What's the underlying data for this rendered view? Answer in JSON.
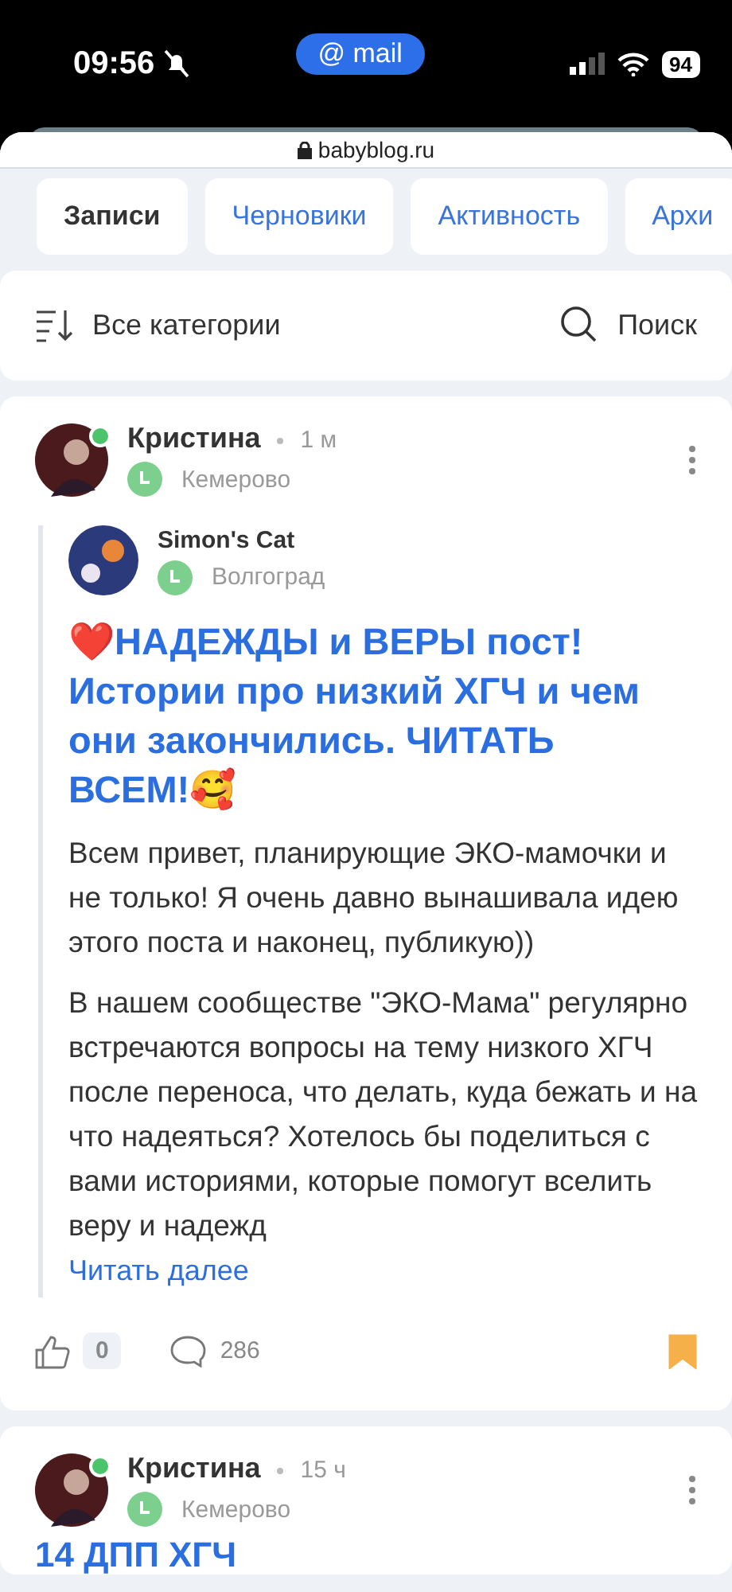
{
  "status_bar": {
    "time": "09:56",
    "app_pill": "@ mail",
    "battery": "94"
  },
  "browser": {
    "url": "babyblog.ru"
  },
  "tabs": [
    {
      "label": "Записи",
      "selected": true
    },
    {
      "label": "Черновики",
      "selected": false
    },
    {
      "label": "Активность",
      "selected": false
    },
    {
      "label": "Архи",
      "selected": false
    }
  ],
  "filter": {
    "category": "Все категории",
    "search": "Поиск"
  },
  "posts": [
    {
      "author": "Кристина",
      "online": true,
      "time": "1 м",
      "city": "Кемерово",
      "repost": {
        "author": "Simon's Cat",
        "city": "Волгоград"
      },
      "title": "❤️НАДЕЖДЫ и ВЕРЫ пост! Истории про низкий ХГЧ и чем они закончились. ЧИТАТЬ ВСЕМ!🥰",
      "paragraphs": [
        "Всем привет, планирующие ЭКО-мамочки и не только! Я очень давно вынашивала идею этого поста и наконец, публикую))",
        "В нашем сообществе \"ЭКО-Мама\" регулярно встречаются вопросы на тему низкого ХГЧ после переноса, что делать, куда бежать и на что надеяться? Хотелось бы поделиться с вами историями, которые помогут вселить веру и надежд"
      ],
      "read_more": "Читать далее",
      "likes": "0",
      "comments": "286",
      "bookmarked": true
    },
    {
      "author": "Кристина",
      "online": true,
      "time": "15 ч",
      "city": "Кемерово",
      "title": "14 ДПП ХГЧ"
    }
  ]
}
